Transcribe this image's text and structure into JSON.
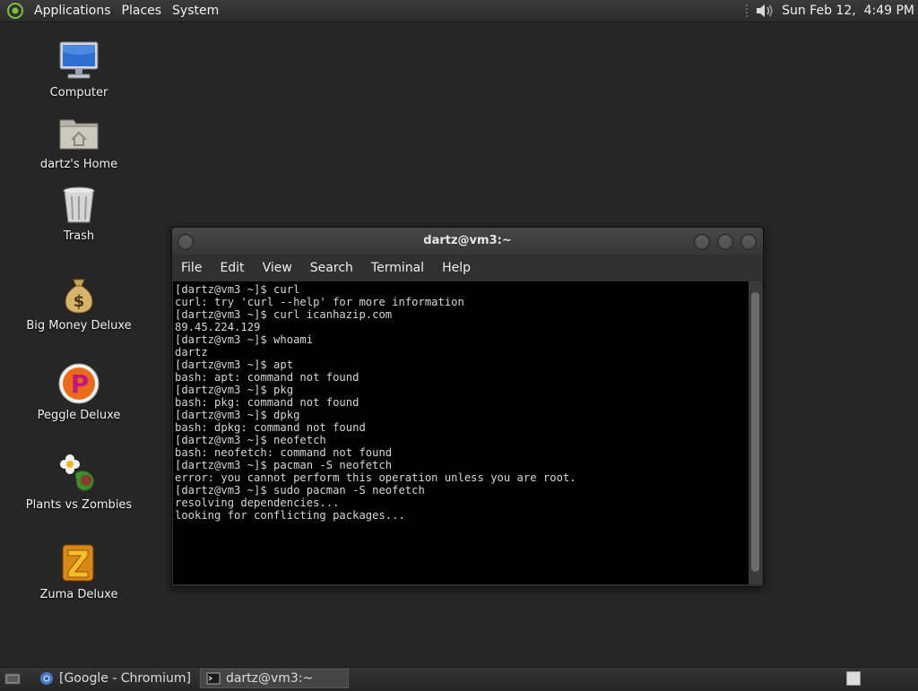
{
  "top_panel": {
    "menus": [
      "Applications",
      "Places",
      "System"
    ],
    "clock": "Sun Feb 12,  4:49 PM"
  },
  "desktop": {
    "icons": [
      {
        "label": "Computer",
        "icon": "computer-icon"
      },
      {
        "label": "dartz's Home",
        "icon": "home-folder-icon"
      },
      {
        "label": "Trash",
        "icon": "trash-icon"
      },
      {
        "label": "Big Money Deluxe",
        "icon": "money-bag-icon"
      },
      {
        "label": "Peggle Deluxe",
        "icon": "peggle-icon"
      },
      {
        "label": "Plants vs Zombies",
        "icon": "plants-icon"
      },
      {
        "label": "Zuma Deluxe",
        "icon": "zuma-icon"
      }
    ]
  },
  "terminal": {
    "title": "dartz@vm3:~",
    "menu": [
      "File",
      "Edit",
      "View",
      "Search",
      "Terminal",
      "Help"
    ],
    "lines": [
      "[dartz@vm3 ~]$ curl",
      "curl: try 'curl --help' for more information",
      "[dartz@vm3 ~]$ curl icanhazip.com",
      "89.45.224.129",
      "[dartz@vm3 ~]$ whoami",
      "dartz",
      "[dartz@vm3 ~]$ apt",
      "bash: apt: command not found",
      "[dartz@vm3 ~]$ pkg",
      "bash: pkg: command not found",
      "[dartz@vm3 ~]$ dpkg",
      "bash: dpkg: command not found",
      "[dartz@vm3 ~]$ neofetch",
      "bash: neofetch: command not found",
      "[dartz@vm3 ~]$ pacman -S neofetch",
      "error: you cannot perform this operation unless you are root.",
      "[dartz@vm3 ~]$ sudo pacman -S neofetch",
      "resolving dependencies...",
      "looking for conflicting packages..."
    ]
  },
  "taskbar": {
    "tasks": [
      {
        "label": "[Google - Chromium]",
        "icon": "chromium-icon",
        "active": false
      },
      {
        "label": "dartz@vm3:~",
        "icon": "terminal-icon",
        "active": true
      }
    ]
  }
}
